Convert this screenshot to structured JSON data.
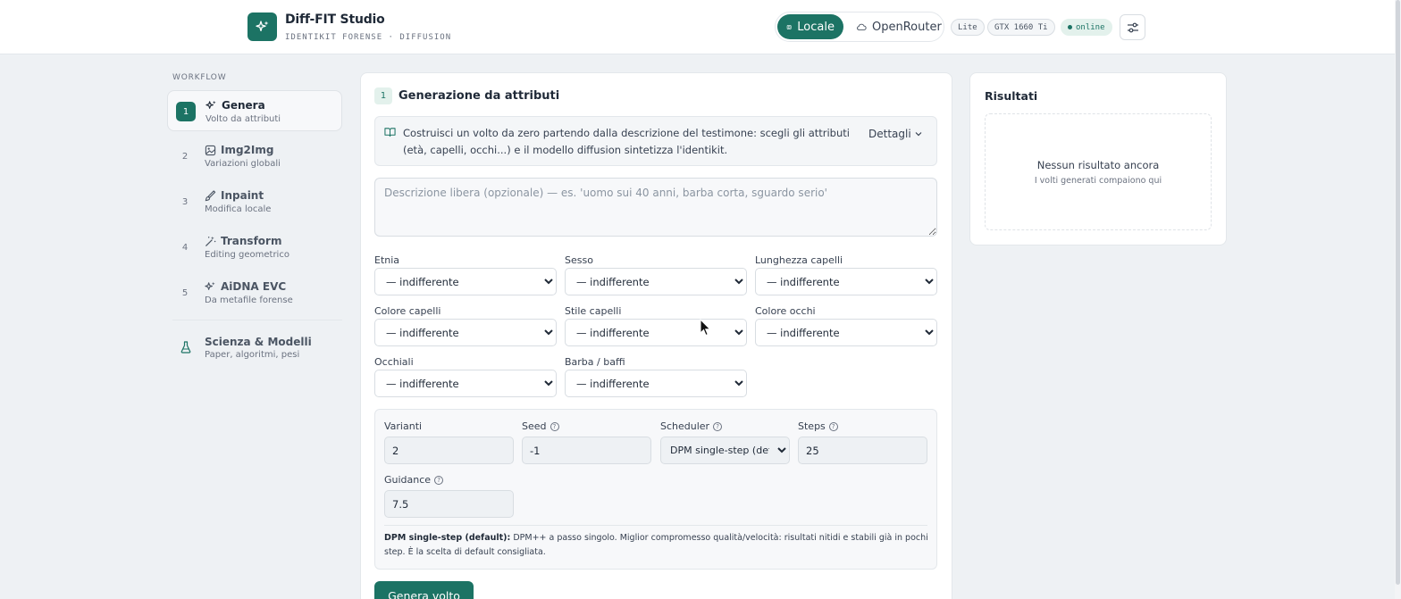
{
  "header": {
    "app_title": "Diff-FIT Studio",
    "app_subtitle": "IDENTIKIT FORENSE · DIFFUSION",
    "mode_local": "Locale",
    "mode_openrouter": "OpenRouter",
    "chip_lite": "Lite",
    "chip_gpu": "GTX 1660 Ti",
    "chip_status": "online"
  },
  "sidebar": {
    "section_label": "WORKFLOW",
    "items": [
      {
        "num": "1",
        "title": "Genera",
        "sub": "Volto da attributi"
      },
      {
        "num": "2",
        "title": "Img2Img",
        "sub": "Variazioni globali"
      },
      {
        "num": "3",
        "title": "Inpaint",
        "sub": "Modifica locale"
      },
      {
        "num": "4",
        "title": "Transform",
        "sub": "Editing geometrico"
      },
      {
        "num": "5",
        "title": "AiDNA EVC",
        "sub": "Da metafile forense"
      }
    ],
    "science": {
      "title": "Scienza & Modelli",
      "sub": "Paper, algoritmi, pesi"
    }
  },
  "main": {
    "step": "1",
    "title": "Generazione da attributi",
    "info_text": "Costruisci un volto da zero partendo dalla descrizione del testimone: scegli gli attributi (età, capelli, occhi...) e il modello diffusion sintetizza l'identikit.",
    "details_label": "Dettagli",
    "description_placeholder": "Descrizione libera (opzionale) — es. 'uomo sui 40 anni, barba corta, sguardo serio'",
    "fields": [
      {
        "label": "Etnia",
        "value": "— indifferente"
      },
      {
        "label": "Sesso",
        "value": "— indifferente"
      },
      {
        "label": "Lunghezza capelli",
        "value": "— indifferente"
      },
      {
        "label": "Colore capelli",
        "value": "— indifferente"
      },
      {
        "label": "Stile capelli",
        "value": "— indifferente"
      },
      {
        "label": "Colore occhi",
        "value": "— indifferente"
      },
      {
        "label": "Occhiali",
        "value": "— indifferente"
      },
      {
        "label": "Barba / baffi",
        "value": "— indifferente"
      }
    ],
    "params": {
      "variants_label": "Varianti",
      "variants_value": "2",
      "seed_label": "Seed",
      "seed_value": "-1",
      "scheduler_label": "Scheduler",
      "scheduler_value": "DPM single-step (default)",
      "steps_label": "Steps",
      "steps_value": "25",
      "guidance_label": "Guidance",
      "guidance_value": "7.5",
      "scheduler_desc_bold": "DPM single-step (default):",
      "scheduler_desc": "DPM++ a passo singolo. Miglior compromesso qualità/velocità: risultati nitidi e stabili già in pochi step. È la scelta di default consigliata."
    },
    "generate_label": "Genera volto"
  },
  "results": {
    "title": "Risultati",
    "empty_title": "Nessun risultato ancora",
    "empty_sub": "I volti generati compaiono qui"
  },
  "colors": {
    "accent": "#1c7364",
    "accent_light": "#e3f1ec",
    "background": "#eef1f4"
  },
  "icons": [
    "sparkles-icon",
    "chip-icon",
    "cloud-icon",
    "sliders-icon",
    "image-icon",
    "brush-icon",
    "wand-icon",
    "flask-icon",
    "book-icon",
    "chevron-down-icon",
    "help-icon",
    "cursor-icon"
  ]
}
